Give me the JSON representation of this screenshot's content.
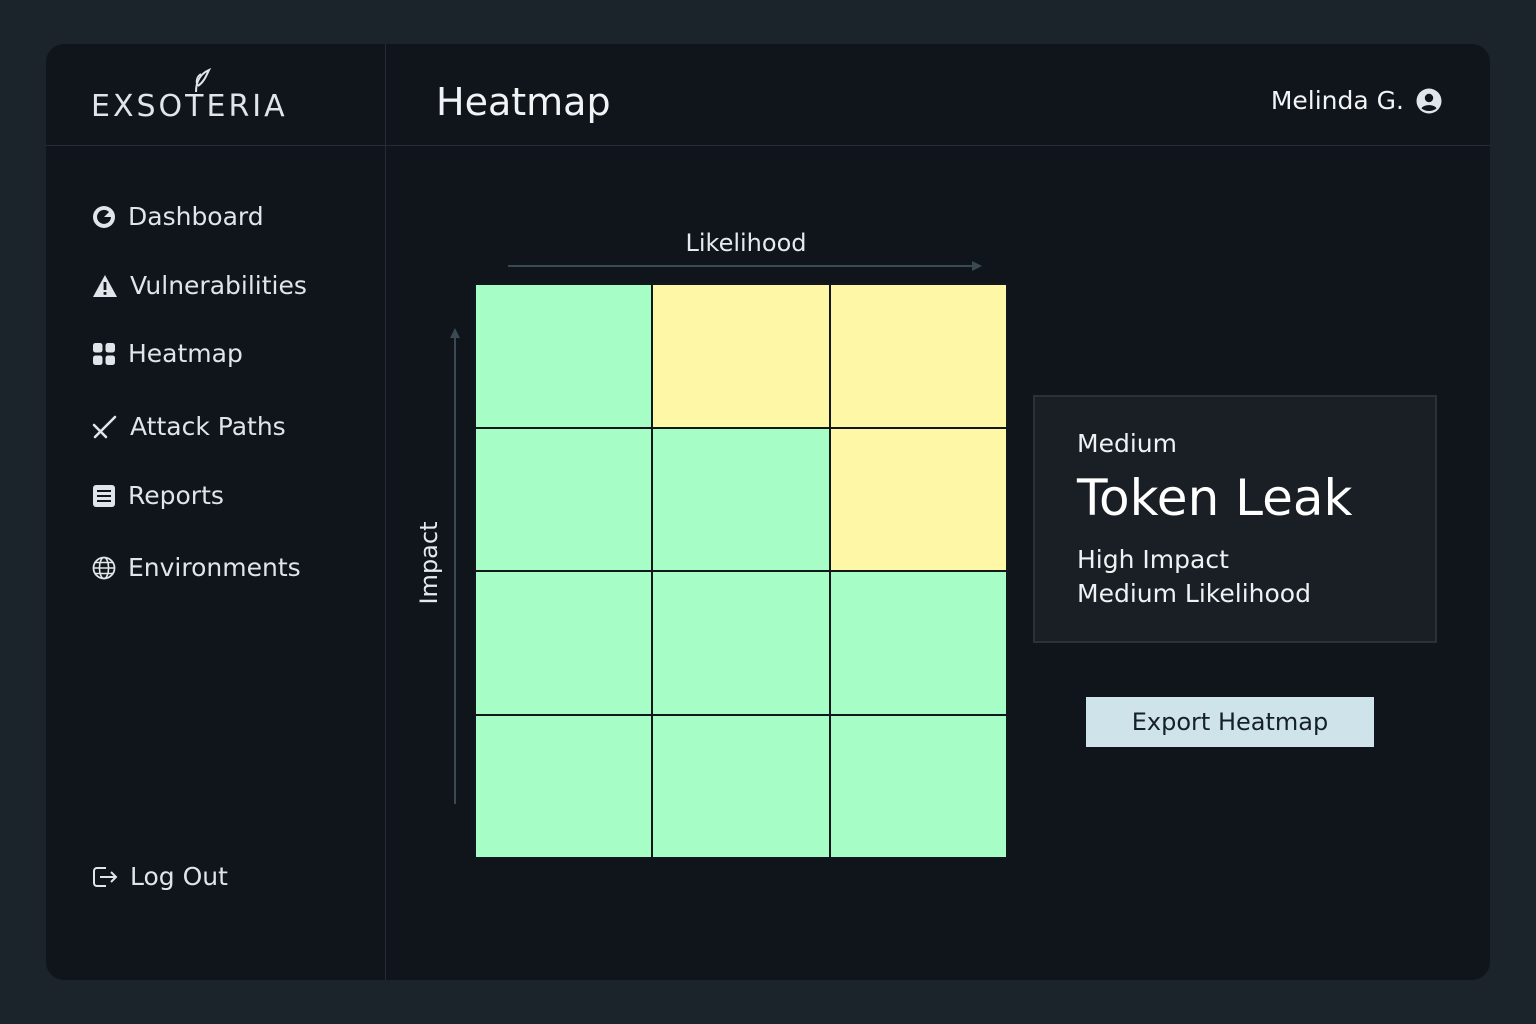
{
  "app": {
    "logo_text": "EXSOTERIA",
    "page_title": "Heatmap",
    "user_name": "Melinda G."
  },
  "sidebar": {
    "items": [
      {
        "label": "Dashboard",
        "icon": "dashboard-icon"
      },
      {
        "label": "Vulnerabilities",
        "icon": "warning-icon"
      },
      {
        "label": "Heatmap",
        "icon": "grid-icon"
      },
      {
        "label": "Attack Paths",
        "icon": "attack-path-icon"
      },
      {
        "label": "Reports",
        "icon": "report-icon"
      },
      {
        "label": "Environments",
        "icon": "globe-icon"
      }
    ],
    "logout_label": "Log Out"
  },
  "heatmap": {
    "x_axis_label": "Likelihood",
    "y_axis_label": "Impact",
    "rows": [
      [
        "green",
        "yellow",
        "yellow"
      ],
      [
        "green",
        "green",
        "yellow"
      ],
      [
        "green",
        "green",
        "green"
      ],
      [
        "green",
        "green",
        "green"
      ]
    ],
    "colors": {
      "green": "#a6fec6",
      "yellow": "#fef7a6"
    }
  },
  "detail": {
    "severity": "Medium",
    "title": "Token Leak",
    "impact": "High Impact",
    "likelihood": "Medium Likelihood"
  },
  "export_label": "Export Heatmap"
}
